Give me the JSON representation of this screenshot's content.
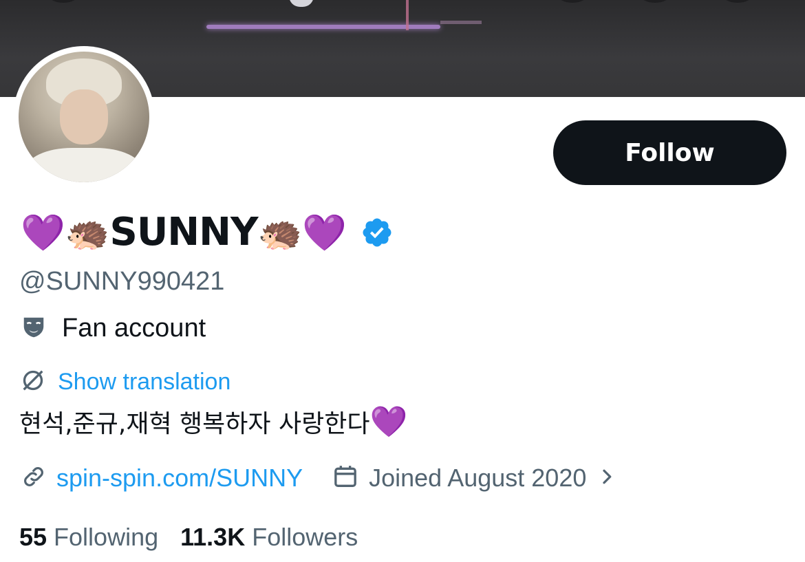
{
  "profile": {
    "display_name": "SUNNY",
    "name_emoji_left": "💜🦔",
    "name_emoji_right": "🦔💜",
    "handle": "@SUNNY990421",
    "category_label": "Fan account",
    "show_translation_label": "Show translation",
    "bio_text": "현석,준규,재혁 행복하자 사랑한다",
    "bio_emoji": "💜",
    "website_link": "spin-spin.com/SUNNY",
    "joined_text": "Joined August 2020",
    "following_count": "55",
    "following_label": "Following",
    "followers_count": "11.3K",
    "followers_label": "Followers"
  },
  "actions": {
    "follow_label": "Follow"
  },
  "icons": {
    "verified": "verified-badge-icon",
    "category": "fan-mask-icon",
    "translate": "translation-globe-icon",
    "link": "link-icon",
    "calendar": "calendar-icon",
    "chevron": "chevron-right-icon"
  },
  "colors": {
    "accent": "#1d9bf0",
    "text": "#0f1419",
    "secondary": "#536471",
    "button_bg": "#0f1419"
  }
}
